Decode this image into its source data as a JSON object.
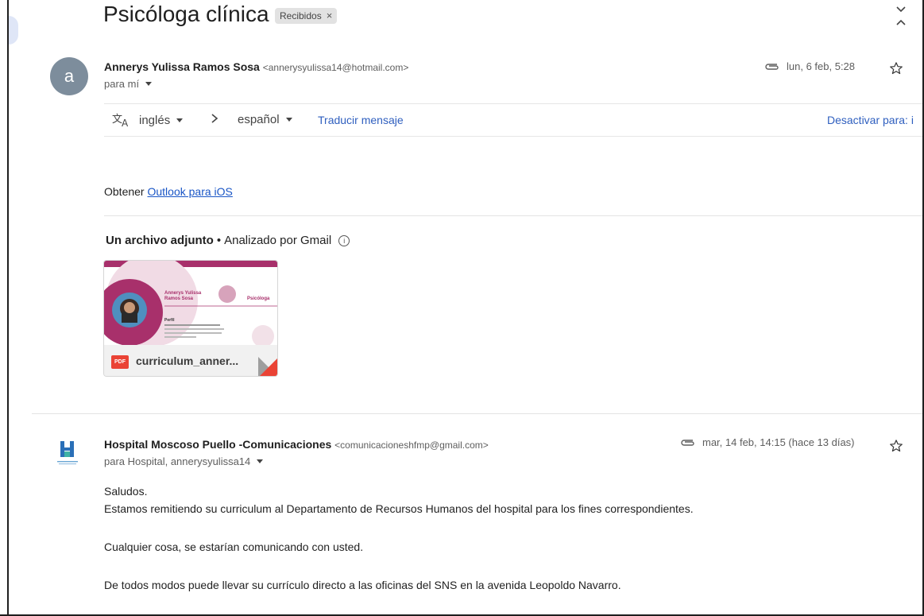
{
  "thread": {
    "subject": "Psicóloga clínica",
    "label": "Recibidos",
    "label_close": "×"
  },
  "message1": {
    "avatar_letter": "a",
    "sender_name": "Annerys Yulissa Ramos Sosa",
    "sender_email": "<annerysyulissa14@hotmail.com>",
    "to": "para mí",
    "date": "lun, 6 feb, 5:28",
    "translate": {
      "from_lang": "inglés",
      "to_lang": "español",
      "translate_link": "Traducir mensaje",
      "disable_link": "Desactivar para: i"
    },
    "body_prefix": "Obtener",
    "body_link": "Outlook para iOS",
    "attachments": {
      "heading": "Un archivo adjunto",
      "separator": "•",
      "scanned": "Analizado por Gmail",
      "info_glyph": "i",
      "file_name": "curriculum_anner...",
      "file_type": "PDF",
      "preview": {
        "name_line1": "Annerys Yulissa",
        "name_line2": "Ramos Sosa",
        "role": "Psicóloga",
        "section": "Perfil"
      }
    }
  },
  "message2": {
    "sender_name": "Hospital Moscoso Puello -Comunicaciones",
    "sender_email": "<comunicacioneshfmp@gmail.com>",
    "to": "para Hospital, annerysyulissa14",
    "date": "mar, 14 feb, 14:15 (hace 13 días)",
    "body": [
      "Saludos.",
      "Estamos remitiendo su curriculum al Departamento de Recursos Humanos del hospital para los fines correspondientes.",
      "Cualquier cosa, se estarían comunicando con usted.",
      "De todos modos puede llevar su currículo directo a las oficinas del SNS en la avenida Leopoldo Navarro."
    ]
  },
  "colors": {
    "link": "#1a56c6",
    "accent_magenta": "#a8306b",
    "pdf_red": "#ea4335",
    "avatar_bg": "#7d8d9c"
  }
}
